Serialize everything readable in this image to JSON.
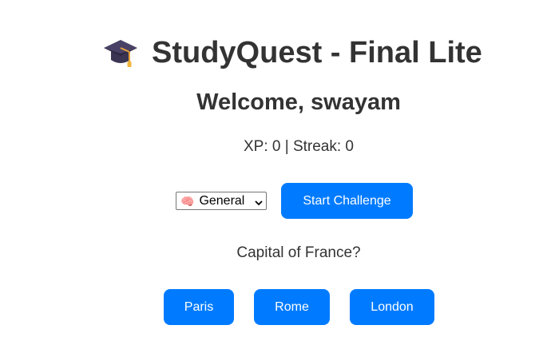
{
  "app": {
    "icon": "graduation-cap-icon",
    "title": "StudyQuest - Final Lite"
  },
  "welcome": "Welcome, swayam",
  "stats": "XP: 0 | Streak: 0",
  "category_select": {
    "icon": "brain-icon",
    "selected": "General"
  },
  "start_button": "Start Challenge",
  "question": "Capital of France?",
  "answers": [
    {
      "label": "Paris"
    },
    {
      "label": "Rome"
    },
    {
      "label": "London"
    }
  ],
  "colors": {
    "accent": "#007bff",
    "text": "#333333",
    "background": "#ffffff"
  }
}
